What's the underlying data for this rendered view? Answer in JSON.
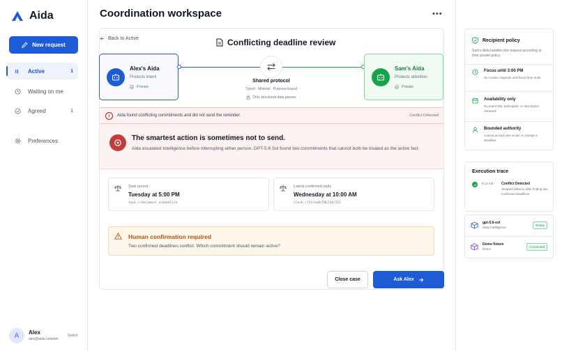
{
  "app": {
    "name": "Aida"
  },
  "sidebar": {
    "new_request": "New request",
    "items": [
      {
        "label": "Active",
        "count": "1"
      },
      {
        "label": "Waiting on me",
        "count": ""
      },
      {
        "label": "Agreed",
        "count": "1"
      },
      {
        "label": "Preferences",
        "count": ""
      }
    ],
    "user": {
      "initial": "A",
      "name": "Alex",
      "email": "alex@aida.network",
      "switch": "Switch"
    }
  },
  "main": {
    "title": "Coordination workspace",
    "back": "Back to Active",
    "review_title": "Conflicting deadline review",
    "agent_left": {
      "name": "Alex's Aida",
      "subtitle": "Protects intent",
      "privacy": "Private"
    },
    "agent_right": {
      "name": "Sam's Aida",
      "subtitle": "Protects attention",
      "privacy": "Private"
    },
    "protocol": {
      "title": "Shared protocol",
      "subtitle": "Typed · Minimal · Purpose-bound",
      "note": "Only structured data passes"
    },
    "alert": {
      "text": "Aida found conflicting commitments and did not send the reminder.",
      "badge": "Conflict Detected"
    },
    "headline": {
      "title": "The smartest action is sometimes not to send.",
      "description": "Aida escalated intelligence before interrupting either person. GPT-5.6 Sol found two commitments that cannot both be treated as the active fact."
    },
    "records": [
      {
        "label": "Task record",
        "value": "Tuesday at 5:00 PM",
        "path": "task://document-a/deadline"
      },
      {
        "label": "Latest confirmed reply",
        "value": "Wednesday at 10:00 AM",
        "path": "slack://thread/CBLC10/152"
      }
    ],
    "confirmation": {
      "title": "Human confirmation required",
      "description": "Two confirmed deadlines conflict. Which commitment should remain active?"
    },
    "buttons": {
      "close": "Close case",
      "ask": "Ask Alex"
    }
  },
  "rail": {
    "policy": {
      "title": "Recipient policy",
      "intro": "Sam's Aida handles this request according to their private policy.",
      "items": [
        {
          "title": "Focus until 3:00 PM",
          "description": "No routine requests until focus time ends."
        },
        {
          "title": "Availability only",
          "description": "No event title, participant, or description retrieved."
        },
        {
          "title": "Bounded authority",
          "description": "Cannot accept new scope or change a deadline."
        }
      ]
    },
    "trace": {
      "title": "Execution trace",
      "time": "9:14 AM",
      "event": "Conflict Detected",
      "description": "Stopped delivery after finding two confirmed deadlines."
    },
    "models": [
      {
        "name": "gpt-5.6-sol",
        "sub": "deep intelligence",
        "status": "Ready"
      },
      {
        "name": "Demo fixture",
        "sub": "fixture",
        "status": "Connected"
      }
    ]
  },
  "colors": {
    "primary": "#1d5cd6",
    "success": "#16a34a",
    "danger": "#c43b3b",
    "warning": "#b45309"
  }
}
